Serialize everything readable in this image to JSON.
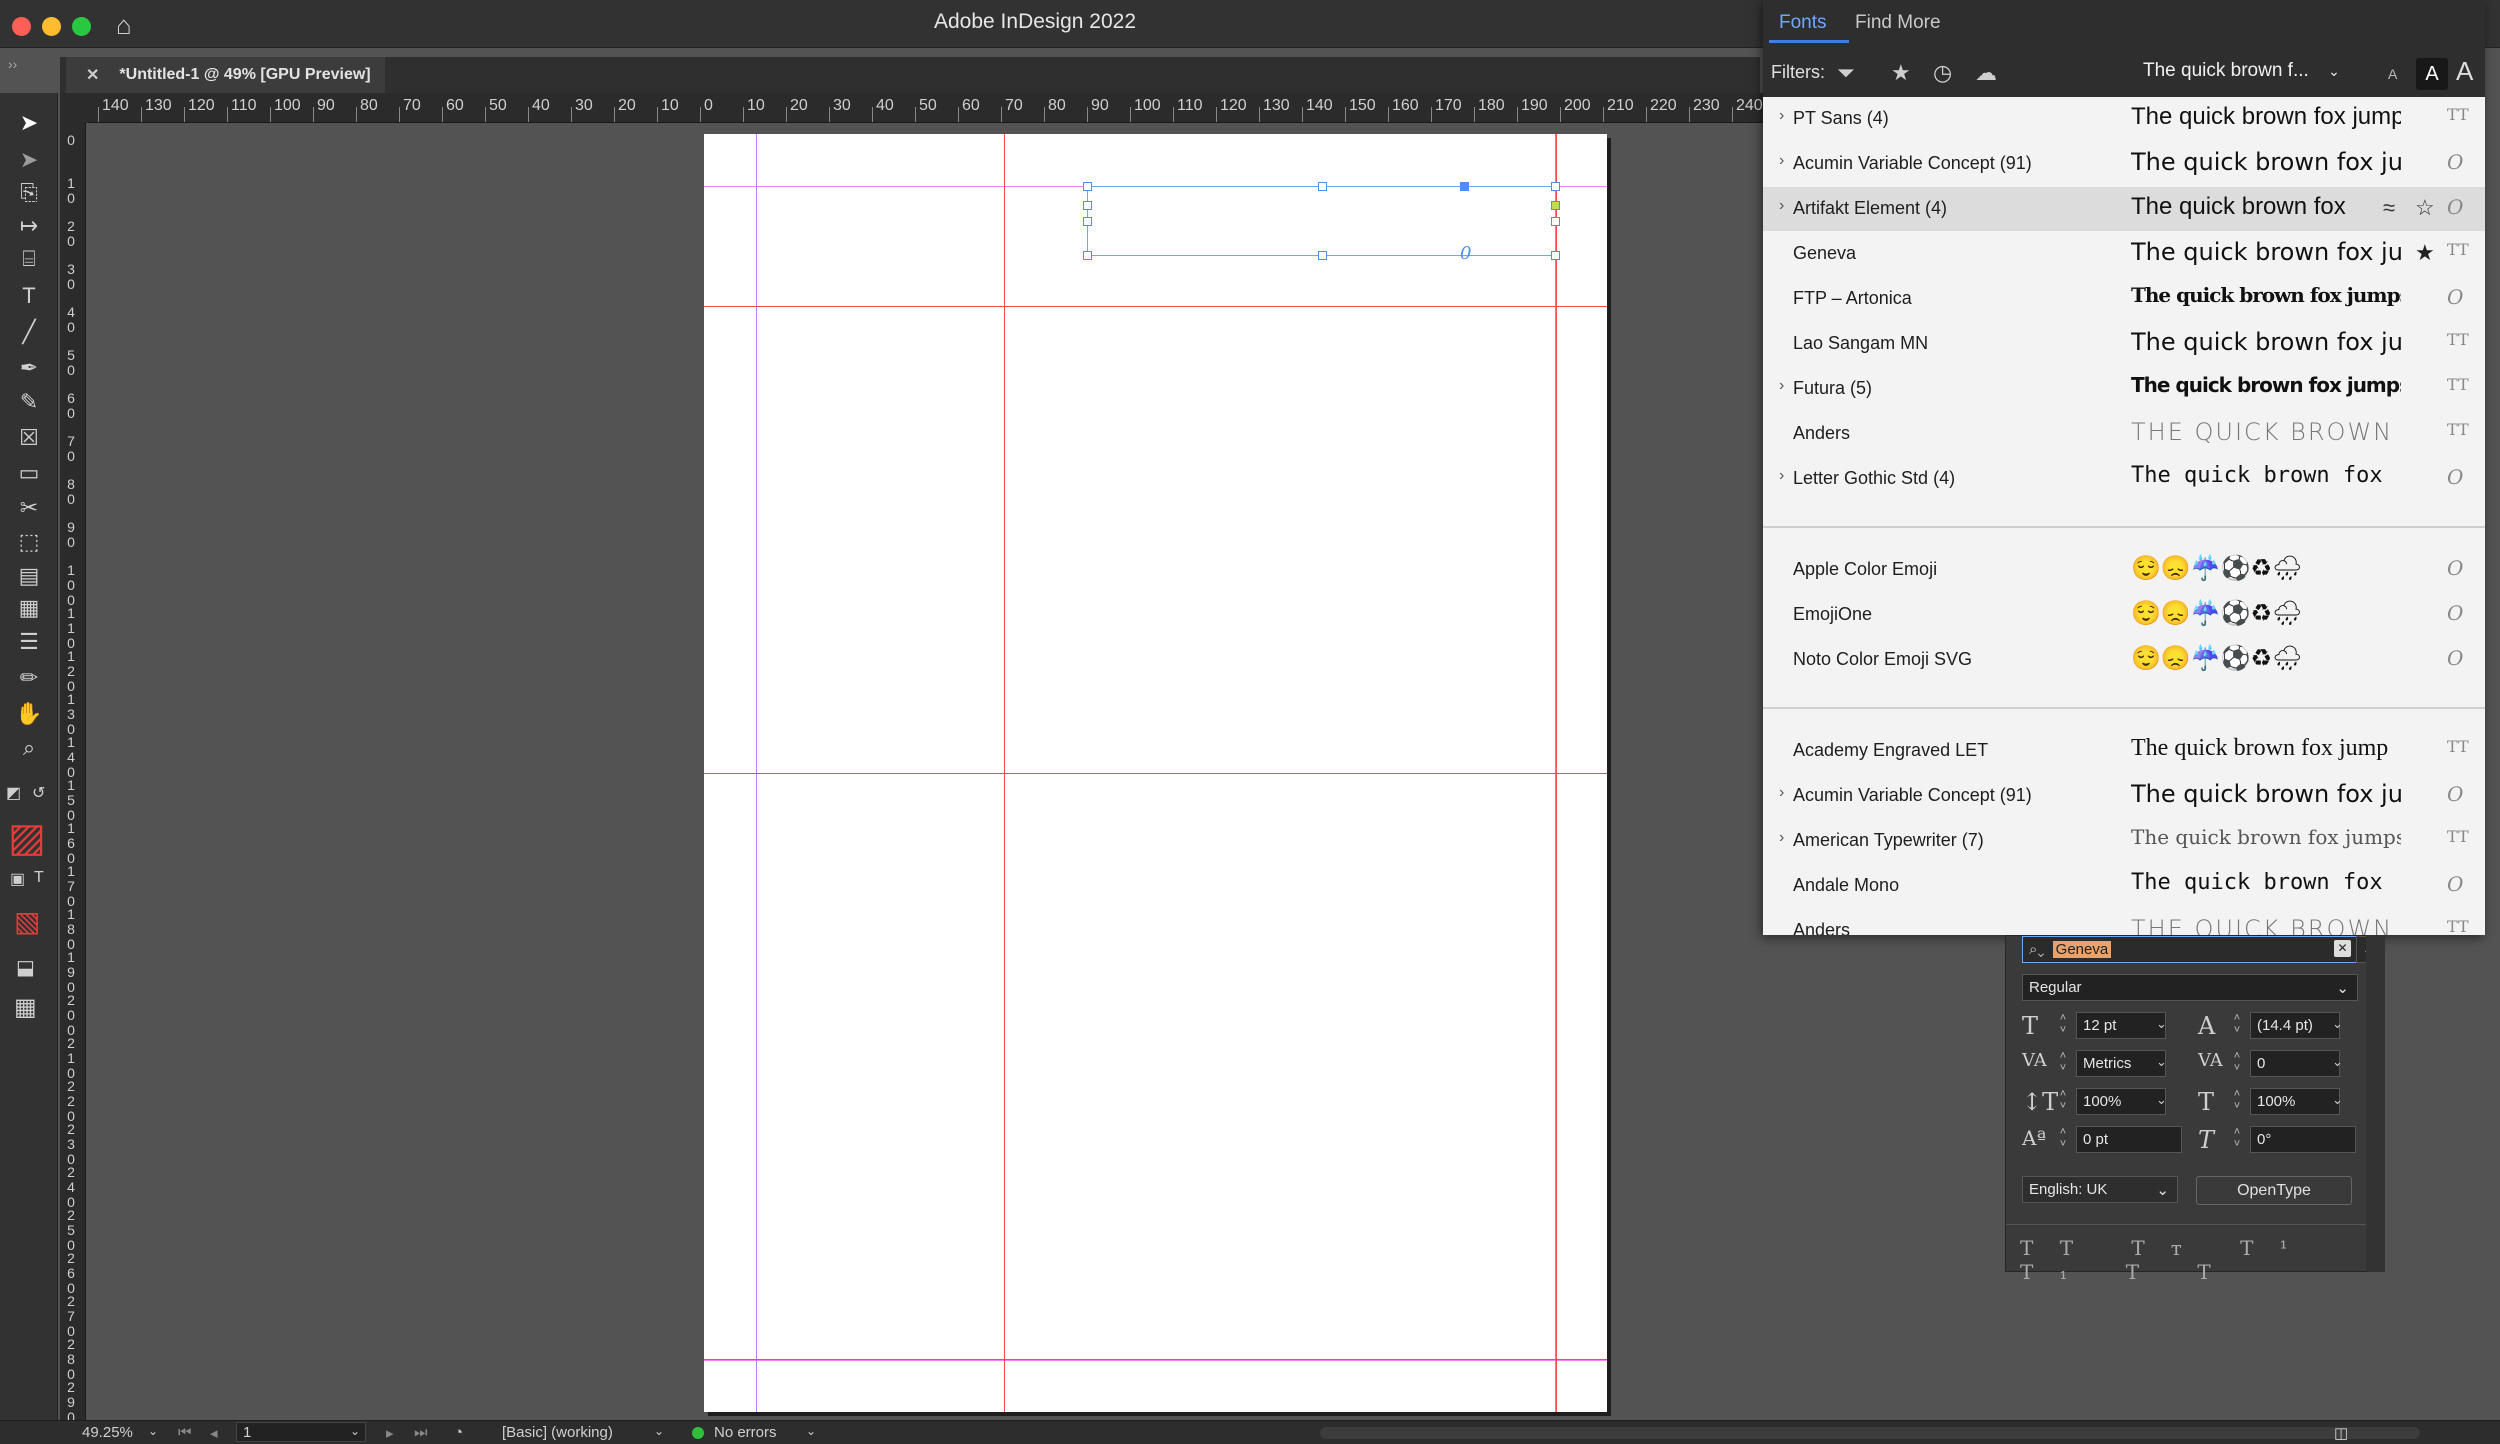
{
  "app": {
    "title": "Adobe InDesign 2022"
  },
  "document": {
    "tab_label": "*Untitled-1 @ 49% [GPU Preview]",
    "close_glyph": "✕"
  },
  "ruler": {
    "h_labels": [
      "140",
      "130",
      "120",
      "110",
      "100",
      "90",
      "80",
      "70",
      "60",
      "50",
      "40",
      "30",
      "20",
      "10",
      "0",
      "10",
      "20",
      "30",
      "40",
      "50",
      "60",
      "70",
      "80",
      "90",
      "100",
      "110",
      "120",
      "130",
      "140",
      "150",
      "160",
      "170",
      "180",
      "190",
      "200",
      "210",
      "220",
      "230",
      "240"
    ],
    "v_labels": [
      "0",
      "10",
      "20",
      "30",
      "40",
      "50",
      "60",
      "70",
      "80",
      "90",
      "100",
      "110",
      "120",
      "130",
      "140",
      "150",
      "160",
      "170",
      "180",
      "190",
      "200",
      "210",
      "220",
      "230",
      "240",
      "250",
      "260",
      "270",
      "280",
      "290"
    ]
  },
  "toolbar": {
    "icons": [
      "selection-tool-icon",
      "direct-selection-tool-icon",
      "page-tool-icon",
      "gap-tool-icon",
      "content-collector-icon",
      "type-tool-icon",
      "line-tool-icon",
      "pen-tool-icon",
      "pencil-tool-icon",
      "rectangle-frame-tool-icon",
      "rectangle-tool-icon",
      "scissors-tool-icon",
      "free-transform-tool-icon",
      "gradient-swatch-tool-icon",
      "gradient-feather-tool-icon",
      "note-tool-icon",
      "eyedropper-tool-icon",
      "hand-tool-icon",
      "zoom-tool-icon"
    ],
    "glyphs": [
      "➤",
      "➤",
      "⎘",
      "↦",
      "⌸",
      "T",
      "╱",
      "✒",
      "✎",
      "☒",
      "▭",
      "✂",
      "⬚",
      "▤",
      "▦",
      "☰",
      "✏",
      "✋",
      "⌕"
    ]
  },
  "fonts_panel": {
    "tabs": [
      "Fonts",
      "Find More"
    ],
    "filters_label": "Filters:",
    "sample_text": "The quick brown f...",
    "groups": [
      [
        {
          "name": "PT Sans (4)",
          "expandable": true,
          "sample": "The quick brown fox jumps",
          "type": "TT"
        },
        {
          "name": "Acumin Variable Concept (91)",
          "expandable": true,
          "sample": "The quick brown fox jumps",
          "type": "O"
        },
        {
          "name": "Artifakt Element (4)",
          "expandable": true,
          "sample": "The quick brown fox",
          "type": "O",
          "selected": true
        },
        {
          "name": "Geneva",
          "expandable": false,
          "sample": "The quick brown fox jumps",
          "type": "TT"
        },
        {
          "name": "FTP – Artonica",
          "expandable": false,
          "sample": "The quick brown fox jumps over",
          "type": "O"
        },
        {
          "name": "Lao Sangam MN",
          "expandable": false,
          "sample": "The quick brown fox jumps",
          "type": "TT"
        },
        {
          "name": "Futura (5)",
          "expandable": true,
          "sample": "The quick brown fox jumps over laz",
          "type": "TT"
        },
        {
          "name": "Anders",
          "expandable": false,
          "sample": "THE QUICK BROWN F",
          "type": "TT"
        },
        {
          "name": "Letter Gothic Std (4)",
          "expandable": true,
          "sample": "The quick brown fox",
          "type": "O"
        }
      ],
      [
        {
          "name": "Apple Color Emoji",
          "expandable": false,
          "sample": "😌😞☔⚽♻🌧",
          "type": "O"
        },
        {
          "name": "EmojiOne",
          "expandable": false,
          "sample": "😌😞☔⚽♻🌧",
          "type": "O"
        },
        {
          "name": "Noto Color Emoji SVG",
          "expandable": false,
          "sample": "😌😞☔⚽♻🌧",
          "type": "O"
        }
      ],
      [
        {
          "name": "Academy Engraved LET",
          "expandable": false,
          "sample": "The quick brown fox jump",
          "type": "TT"
        },
        {
          "name": "Acumin Variable Concept (91)",
          "expandable": true,
          "sample": "The quick brown fox jumps",
          "type": "O"
        },
        {
          "name": "American Typewriter (7)",
          "expandable": true,
          "sample": "The quick brown fox jumps ov",
          "type": "TT"
        },
        {
          "name": "Andale Mono",
          "expandable": false,
          "sample": "The quick brown fox",
          "type": "O"
        },
        {
          "name": "Anders",
          "expandable": false,
          "sample": "THE QUICK BROWN F",
          "type": "TT"
        }
      ]
    ]
  },
  "character_panel": {
    "font_search": "Geneva",
    "font_style": "Regular",
    "font_size": "12 pt",
    "leading": "(14.4 pt)",
    "kerning": "Metrics",
    "tracking": "0",
    "vertical_scale": "100%",
    "horizontal_scale": "100%",
    "baseline_shift": "0 pt",
    "skew": "0°",
    "language": "English: UK",
    "opentype_label": "OpenType",
    "caps_glyphs": "TT Tᴛ T¹ T₁ T T"
  },
  "status": {
    "zoom": "49.25%",
    "page": "1",
    "style": "[Basic] (working)",
    "preflight": "No errors"
  },
  "colors": {
    "accent": "#3f7fe0",
    "guide": "#ff4a4a",
    "margin": "#ff7bff",
    "ok": "#2fbf3a"
  }
}
